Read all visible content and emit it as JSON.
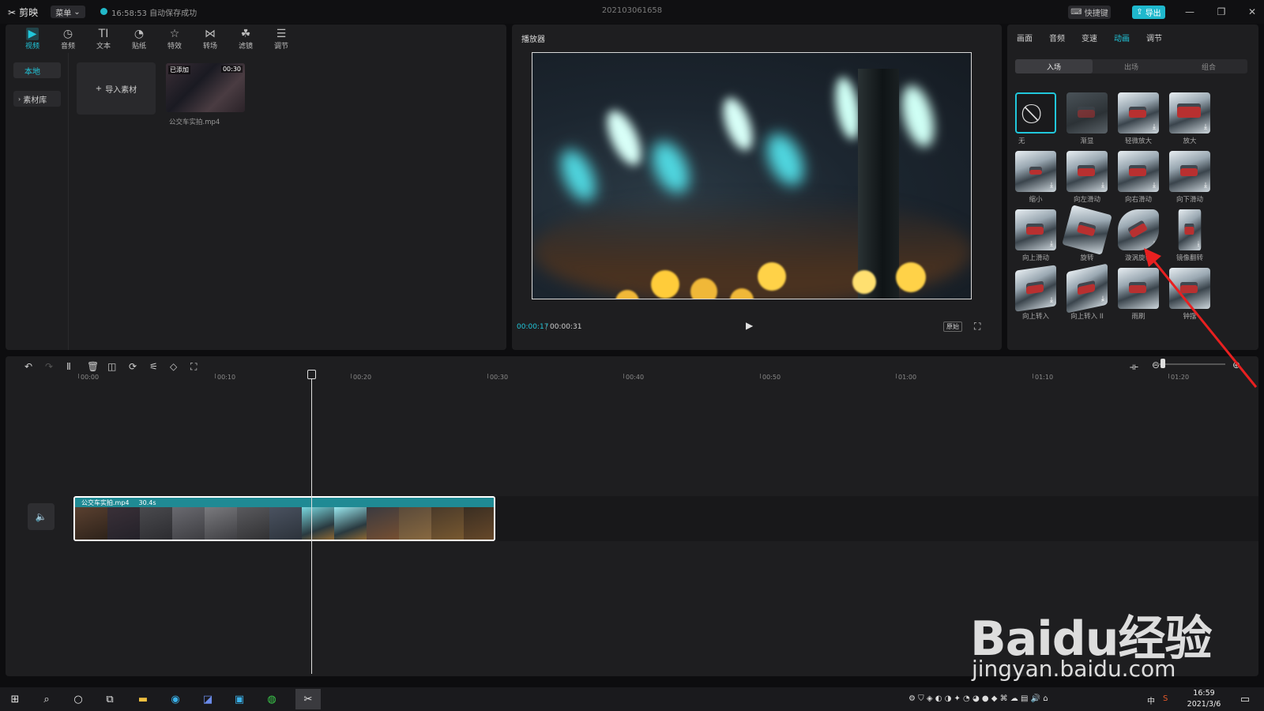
{
  "app": {
    "name": "剪映",
    "menu_label": "菜单",
    "autosave_text": "16:58:53 自动保存成功",
    "project_title": "202103061658",
    "shortcut_label": "快捷键",
    "export_label": "导出",
    "accent_color": "#21c7db"
  },
  "media_toolbar": [
    {
      "label": "视频",
      "icon": "video-icon",
      "active": true
    },
    {
      "label": "音频",
      "icon": "audio-icon"
    },
    {
      "label": "文本",
      "icon": "text-icon"
    },
    {
      "label": "贴纸",
      "icon": "sticker-icon"
    },
    {
      "label": "特效",
      "icon": "effects-icon"
    },
    {
      "label": "转场",
      "icon": "transition-icon"
    },
    {
      "label": "滤镜",
      "icon": "filter-icon"
    },
    {
      "label": "调节",
      "icon": "adjust-icon"
    }
  ],
  "media_sidebar": {
    "local": "本地",
    "library": "素材库"
  },
  "media": {
    "import_label": "导入素材",
    "clip": {
      "badge": "已添加",
      "duration": "00:30",
      "filename": "公交车实拍.mp4"
    }
  },
  "player": {
    "title": "播放器",
    "current_time": "00:00:17",
    "total_time": "00:00:31",
    "ratio_label": "原始"
  },
  "props": {
    "tabs": [
      "画面",
      "音频",
      "变速",
      "动画",
      "调节"
    ],
    "active_tab": "动画",
    "sub_tabs": [
      "入场",
      "出场",
      "组合"
    ],
    "animations": [
      {
        "label": "无"
      },
      {
        "label": "渐显"
      },
      {
        "label": "轻微放大"
      },
      {
        "label": "放大"
      },
      {
        "label": "缩小"
      },
      {
        "label": "向左滑动"
      },
      {
        "label": "向右滑动"
      },
      {
        "label": "向下滑动"
      },
      {
        "label": "向上滑动"
      },
      {
        "label": "旋转"
      },
      {
        "label": "漩涡旋转"
      },
      {
        "label": "镜像翻转"
      },
      {
        "label": "向上转入"
      },
      {
        "label": "向上转入 II"
      },
      {
        "label": "雨刷"
      },
      {
        "label": "钟摆"
      }
    ]
  },
  "timeline": {
    "ruler": [
      "00:00",
      "00:10",
      "00:20",
      "00:30",
      "00:40",
      "00:50",
      "01:00",
      "01:10",
      "01:20"
    ],
    "clip_name": "公交车实拍.mp4",
    "clip_duration": "30.4s"
  },
  "taskbar": {
    "time": "16:59",
    "date": "2021/3/6",
    "ime": "中"
  },
  "watermark": {
    "main": "Baidu经验",
    "sub": "jingyan.baidu.com"
  }
}
